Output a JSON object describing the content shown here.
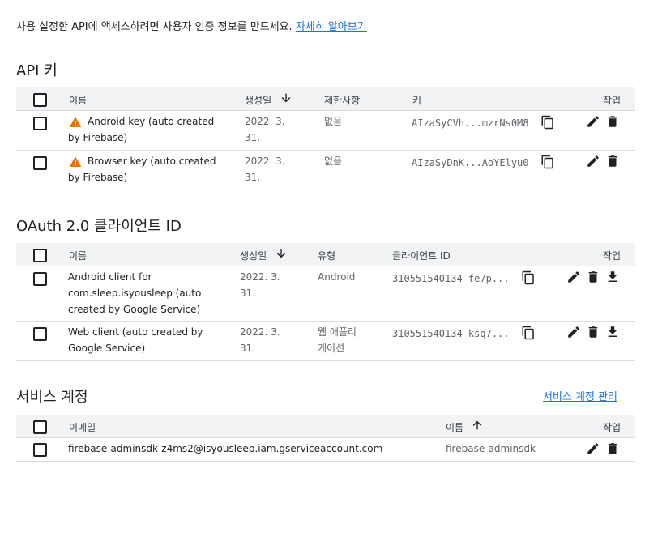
{
  "intro": {
    "text": "사용 설정한 API에 액세스하려면 사용자 인증 정보를 만드세요.",
    "link": "자세히 알아보기"
  },
  "api_keys": {
    "title": "API 키",
    "headers": {
      "name": "이름",
      "created": "생성일",
      "restrictions": "제한사항",
      "key": "키",
      "actions": "작업"
    },
    "rows": [
      {
        "name_line1": "Android key (auto created",
        "name_line2": "by Firebase)",
        "date_line1": "2022. 3.",
        "date_line2": "31.",
        "restriction": "없음",
        "key": "AIzaSyCVh...mzrNs0M8"
      },
      {
        "name_line1": "Browser key (auto created",
        "name_line2": "by Firebase)",
        "date_line1": "2022. 3.",
        "date_line2": "31.",
        "restriction": "없음",
        "key": "AIzaSyDnK...AoYElyu0"
      }
    ]
  },
  "oauth": {
    "title": "OAuth 2.0 클라이언트 ID",
    "headers": {
      "name": "이름",
      "created": "생성일",
      "type": "유형",
      "client_id": "클라이언트 ID",
      "actions": "작업"
    },
    "rows": [
      {
        "name_line1": "Android client for",
        "name_line2": "com.sleep.isyousleep (auto",
        "name_line3": "created by Google Service)",
        "date_line1": "2022. 3.",
        "date_line2": "31.",
        "type_line1": "Android",
        "type_line2": "",
        "client_id": "310551540134-fe7p..."
      },
      {
        "name_line1": "Web client (auto created by",
        "name_line2": "Google Service)",
        "name_line3": "",
        "date_line1": "2022. 3.",
        "date_line2": "31.",
        "type_line1": "웹 애플리",
        "type_line2": "케이션",
        "client_id": "310551540134-ksq7..."
      }
    ]
  },
  "service_accounts": {
    "title": "서비스 계정",
    "manage_link": "서비스 계정 관리",
    "headers": {
      "email": "이메일",
      "name": "이름",
      "actions": "작업"
    },
    "rows": [
      {
        "email": "firebase-adminsdk-z4ms2@isyousleep.iam.gserviceaccount.com",
        "name": "firebase-adminsdk"
      }
    ]
  },
  "colors": {
    "link": "#1a73e8",
    "warning": "#e37400",
    "header_bg": "#f1f3f4",
    "divider": "#dadce0"
  }
}
